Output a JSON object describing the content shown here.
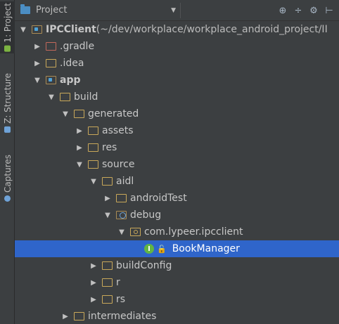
{
  "side": {
    "project_tab": "1: Project",
    "structure_tab": "Z: Structure",
    "captures_tab": "Captures"
  },
  "header": {
    "title": "Project",
    "tools": [
      "⊕",
      "÷",
      "⚙",
      "⊢"
    ]
  },
  "tree": [
    {
      "label": "IPCClient",
      "suffix": " (~/dev/workplace/workplace_android_project/II",
      "arrow": "▼",
      "icon": "mod",
      "bold": true,
      "level": 0
    },
    {
      "label": ".gradle",
      "arrow": "▶",
      "icon": "red",
      "level": 1
    },
    {
      "label": ".idea",
      "arrow": "▶",
      "icon": "plain",
      "level": 1
    },
    {
      "label": "app",
      "arrow": "▼",
      "icon": "mod",
      "bold": true,
      "level": 1
    },
    {
      "label": "build",
      "arrow": "▼",
      "icon": "plain",
      "level": 2
    },
    {
      "label": "generated",
      "arrow": "▼",
      "icon": "plain",
      "level": 3
    },
    {
      "label": "assets",
      "arrow": "▶",
      "icon": "plain",
      "level": 4
    },
    {
      "label": "res",
      "arrow": "▶",
      "icon": "plain",
      "level": 4
    },
    {
      "label": "source",
      "arrow": "▼",
      "icon": "plain",
      "level": 4
    },
    {
      "label": "aidl",
      "arrow": "▼",
      "icon": "plain",
      "level": 5
    },
    {
      "label": "androidTest",
      "arrow": "▶",
      "icon": "plain",
      "level": 6
    },
    {
      "label": "debug",
      "arrow": "▼",
      "icon": "dbg",
      "level": 6
    },
    {
      "label": "com.lypeer.ipcclient",
      "arrow": "▼",
      "icon": "pkg",
      "level": 7
    },
    {
      "label": "BookManager",
      "arrow": "",
      "icon": "interface",
      "level": 8,
      "selected": true
    },
    {
      "label": "buildConfig",
      "arrow": "▶",
      "icon": "plain",
      "level": 5
    },
    {
      "label": "r",
      "arrow": "▶",
      "icon": "plain",
      "level": 5
    },
    {
      "label": "rs",
      "arrow": "▶",
      "icon": "plain",
      "level": 5
    },
    {
      "label": "intermediates",
      "arrow": "▶",
      "icon": "plain",
      "level": 3
    }
  ],
  "colors": {
    "background": "#3c3f41",
    "selection": "#2f65ca",
    "folder": "#c9a85a",
    "interface_badge": "#62b543"
  }
}
